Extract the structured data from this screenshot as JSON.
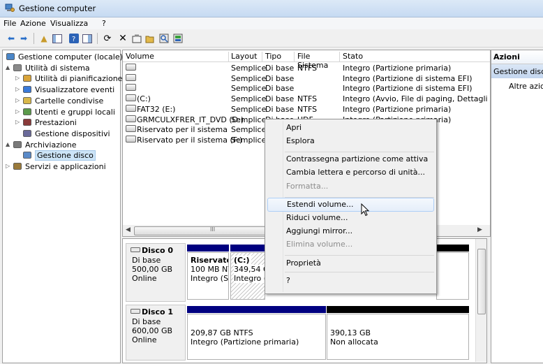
{
  "window": {
    "title": "Gestione computer"
  },
  "menu": [
    "File",
    "Azione",
    "Visualizza",
    "?"
  ],
  "toolbar_icons": [
    "back-icon",
    "forward-icon",
    "up-folder-icon",
    "show-tree-icon",
    "help-icon",
    "console-icon",
    "refresh-icon",
    "delete-icon",
    "properties-icon",
    "open-icon",
    "search-icon",
    "disk-icon"
  ],
  "tree": [
    {
      "label": "Gestione computer (locale)",
      "icon": "computer-management-icon",
      "indent": 0,
      "exp": ""
    },
    {
      "label": "Utilità di sistema",
      "icon": "tools-icon",
      "indent": 1,
      "exp": "▲"
    },
    {
      "label": "Utilità di pianificazione",
      "icon": "clock-icon",
      "indent": 2,
      "exp": "▷"
    },
    {
      "label": "Visualizzatore eventi",
      "icon": "event-viewer-icon",
      "indent": 2,
      "exp": "▷"
    },
    {
      "label": "Cartelle condivise",
      "icon": "shared-folder-icon",
      "indent": 2,
      "exp": "▷"
    },
    {
      "label": "Utenti e gruppi locali",
      "icon": "users-icon",
      "indent": 2,
      "exp": "▷"
    },
    {
      "label": "Prestazioni",
      "icon": "performance-icon",
      "indent": 2,
      "exp": "▷"
    },
    {
      "label": "Gestione dispositivi",
      "icon": "device-manager-icon",
      "indent": 2,
      "exp": ""
    },
    {
      "label": "Archiviazione",
      "icon": "storage-icon",
      "indent": 1,
      "exp": "▲"
    },
    {
      "label": "Gestione disco",
      "icon": "disk-management-icon",
      "indent": 2,
      "exp": "",
      "selected": true
    },
    {
      "label": "Servizi e applicazioni",
      "icon": "services-icon",
      "indent": 1,
      "exp": "▷"
    }
  ],
  "volume_table": {
    "columns": [
      "Volume",
      "Layout",
      "Tipo",
      "File Sistema",
      "Stato"
    ],
    "rows": [
      {
        "volume": "",
        "layout": "Semplice",
        "tipo": "Di base",
        "fs": "NTFS",
        "stato": "Integro (Partizione primaria)"
      },
      {
        "volume": "",
        "layout": "Semplice",
        "tipo": "Di base",
        "fs": "",
        "stato": "Integro (Partizione di sistema EFI)"
      },
      {
        "volume": "",
        "layout": "Semplice",
        "tipo": "Di base",
        "fs": "",
        "stato": "Integro (Partizione di sistema EFI)"
      },
      {
        "volume": "(C:)",
        "layout": "Semplice",
        "tipo": "Di base",
        "fs": "NTFS",
        "stato": "Integro (Avvio, File di paging, Dettagli arresto"
      },
      {
        "volume": "FAT32 (E:)",
        "layout": "Semplice",
        "tipo": "Di base",
        "fs": "NTFS",
        "stato": "Integro (Partizione primaria)"
      },
      {
        "volume": "GRMCULXFRER_IT_DVD (D:)",
        "layout": "Semplice",
        "tipo": "Di base",
        "fs": "UDF",
        "stato": "Integro (Partizione primaria)"
      },
      {
        "volume": "Riservato per il sistema",
        "layout": "Semplice",
        "tipo": "",
        "fs": "",
        "stato": "zione primaria)"
      },
      {
        "volume": "Riservato per il sistema (F:)",
        "layout": "Semplice",
        "tipo": "",
        "fs": "",
        "stato": ""
      }
    ],
    "hscroll_label": "III"
  },
  "disks": [
    {
      "name": "Disco 0",
      "type": "Di base",
      "size": "500,00 GB",
      "status": "Online",
      "partitions": [
        {
          "name": "Riservato",
          "line1": "100 MB NT",
          "line2": "Integro (Si:"
        },
        {
          "name": "(C:)",
          "line1": "349,54 GE",
          "line2": "Integro (A"
        }
      ]
    },
    {
      "name": "Disco 1",
      "type": "Di base",
      "size": "600,00 GB",
      "status": "Online",
      "partitions": [
        {
          "name": "",
          "line1": "209,87 GB NTFS",
          "line2": "Integro (Partizione primaria)"
        },
        {
          "name": "",
          "line1": "390,13 GB",
          "line2": "Non allocata"
        }
      ]
    }
  ],
  "actions": {
    "header": "Azioni",
    "selected": "Gestione disco",
    "item": "Altre azioni"
  },
  "context_menu": [
    {
      "label": "Apri",
      "state": "normal"
    },
    {
      "label": "Esplora",
      "state": "normal"
    },
    {
      "label": "Contrassegna partizione come attiva",
      "state": "normal"
    },
    {
      "label": "Cambia lettera e percorso di unità...",
      "state": "normal"
    },
    {
      "label": "Formatta...",
      "state": "disabled"
    },
    {
      "label": "Estendi volume...",
      "state": "hover"
    },
    {
      "label": "Riduci volume...",
      "state": "normal"
    },
    {
      "label": "Aggiungi mirror...",
      "state": "normal"
    },
    {
      "label": "Elimina volume...",
      "state": "disabled"
    },
    {
      "label": "Proprietà",
      "state": "normal"
    },
    {
      "label": "?",
      "state": "normal"
    }
  ],
  "colors": {
    "primary_partition_bar": "#000080",
    "unallocated_bar": "#000000",
    "selection": "#cce4f7"
  }
}
